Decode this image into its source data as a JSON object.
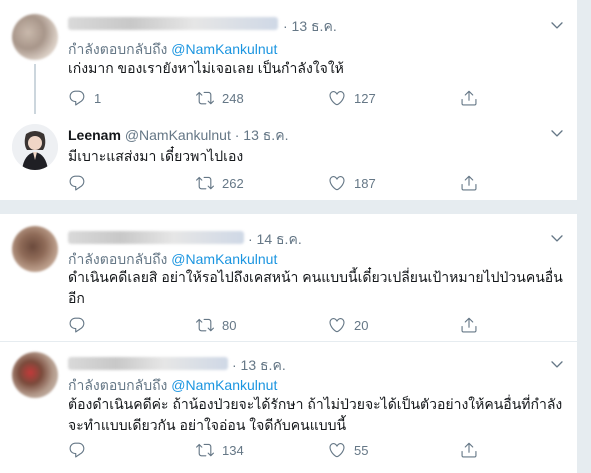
{
  "tweets": [
    {
      "date": "· 13 ธ.ค.",
      "replying_prefix": "กำลังตอบกลับถึง",
      "replying_handle": "@NamKankulnut",
      "text": "เก่งมาก ของเรายังหาไม่เจอเลย เป็นกำลังใจให้",
      "replies": "1",
      "retweets": "248",
      "likes": "127"
    },
    {
      "author_name": "Leenam",
      "author_handle": "@NamKankulnut",
      "date": "· 13 ธ.ค.",
      "text": "มีเบาะแสส่งมา เดี๋ยวพาไปเอง",
      "replies": "",
      "retweets": "262",
      "likes": "187"
    },
    {
      "date": "· 14 ธ.ค.",
      "replying_prefix": "กำลังตอบกลับถึง",
      "replying_handle": "@NamKankulnut",
      "text": "ดำเนินคดีเลยสิ อย่าให้รอไปถึงเคสหน้า คนแบบนี้เดี๋ยวเปลี่ยนเป้าหมายไปป่วนคนอื่น\nอีก",
      "replies": "",
      "retweets": "80",
      "likes": "20"
    },
    {
      "date": "· 13 ธ.ค.",
      "replying_prefix": "กำลังตอบกลับถึง",
      "replying_handle": "@NamKankulnut",
      "text": "ต้องดำเนินคดีค่ะ ถ้าน้องป่วยจะได้รักษา ถ้าไม่ป่วยจะได้เป็นตัวอย่างให้คนอื่นที่กำลัง\nจะทำแบบเดียวกัน อย่าใจอ่อน ใจดีกับคนแบบนี้",
      "replies": "",
      "retweets": "134",
      "likes": "55"
    }
  ],
  "icons": {
    "reply": "reply-icon",
    "retweet": "retweet-icon",
    "like": "heart-icon",
    "share": "share-icon",
    "more": "chevron-down-icon"
  },
  "colors": {
    "link": "#1b95e0",
    "muted": "#657786",
    "text": "#14171a",
    "divider": "#e6ecf0"
  }
}
